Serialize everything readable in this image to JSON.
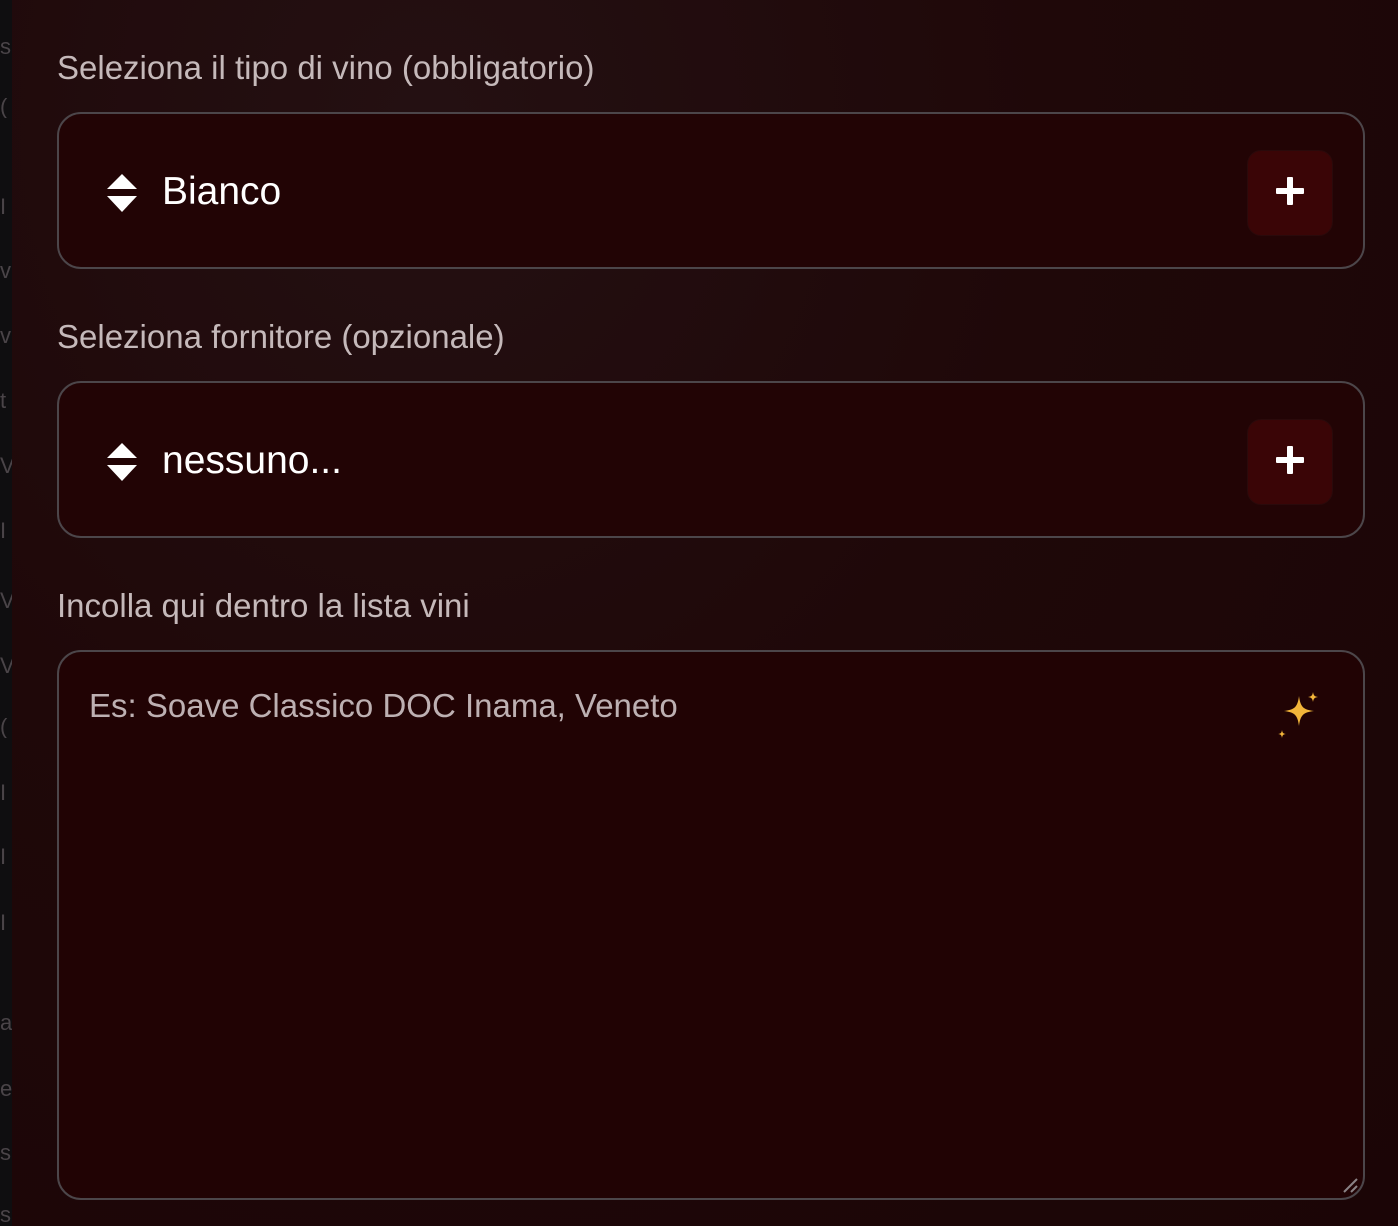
{
  "left_strip_fragments": [
    "s",
    "(",
    "I",
    "v",
    "v",
    "t",
    "V",
    "I",
    "V",
    "V",
    "(",
    "I",
    "I",
    "I",
    "a",
    "e",
    "s",
    "s"
  ],
  "wine_type": {
    "label": "Seleziona il tipo di vino (obbligatorio)",
    "value": "Bianco",
    "add_icon": "plus-icon",
    "sort_icon": "sort-updown-icon"
  },
  "supplier": {
    "label": "Seleziona fornitore (opzionale)",
    "value": "nessuno...",
    "add_icon": "plus-icon",
    "sort_icon": "sort-updown-icon"
  },
  "wine_list": {
    "label": "Incolla qui dentro la lista vini",
    "placeholder": "Es: Soave Classico DOC Inama, Veneto",
    "value": "",
    "ai_icon": "sparkle-icon"
  },
  "colors": {
    "background": "#1b0506",
    "field_background": "#220405",
    "button_background": "#3a0506",
    "border": "#4c464a",
    "label_text": "#c5b9ba",
    "value_text": "#ffffff",
    "sparkle": "#f2b53a"
  }
}
